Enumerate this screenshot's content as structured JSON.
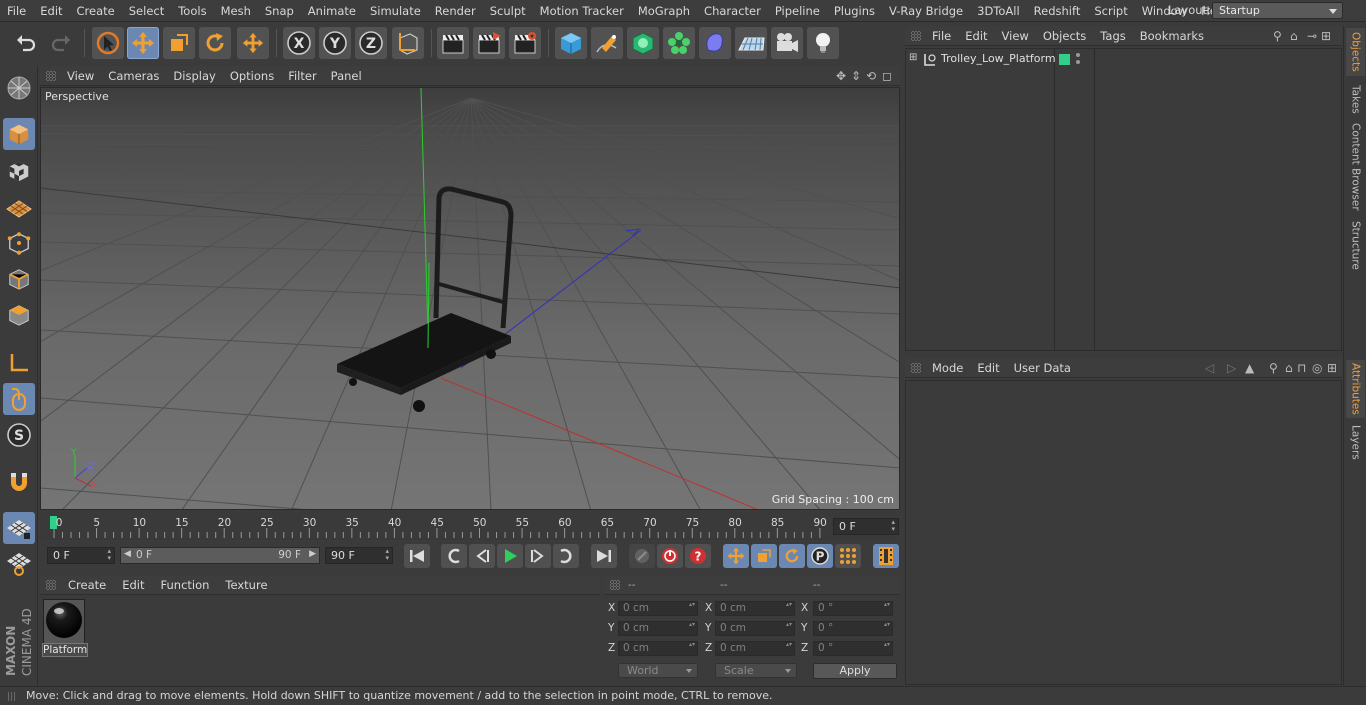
{
  "menubar": {
    "items": [
      "File",
      "Edit",
      "Create",
      "Select",
      "Tools",
      "Mesh",
      "Snap",
      "Animate",
      "Simulate",
      "Render",
      "Sculpt",
      "Motion Tracker",
      "MoGraph",
      "Character",
      "Pipeline",
      "Plugins",
      "V-Ray Bridge",
      "3DToAll",
      "Redshift",
      "Script",
      "Window",
      "Help"
    ],
    "layout_label": "Layout:",
    "layout_value": "Startup"
  },
  "toolbar": {
    "axis_x": "X",
    "axis_y": "Y",
    "axis_z": "Z"
  },
  "viewport": {
    "menu": [
      "View",
      "Cameras",
      "Display",
      "Options",
      "Filter",
      "Panel"
    ],
    "label": "Perspective",
    "grid_spacing": "Grid Spacing : 100 cm",
    "axis_x": "X",
    "axis_y": "Y",
    "axis_z": "Z"
  },
  "timeline": {
    "ticks": [
      "0",
      "5",
      "10",
      "15",
      "20",
      "25",
      "30",
      "35",
      "40",
      "45",
      "50",
      "55",
      "60",
      "65",
      "70",
      "75",
      "80",
      "85",
      "90"
    ],
    "current_frame": "0 F"
  },
  "transport": {
    "start_field": "0 F",
    "range_start": "0 F",
    "range_end": "90 F",
    "end_field": "90 F"
  },
  "material_manager": {
    "menu": [
      "Create",
      "Edit",
      "Function",
      "Texture"
    ],
    "materials": [
      {
        "name": "Platform"
      }
    ]
  },
  "coordinates": {
    "headers": [
      "--",
      "--",
      "--"
    ],
    "rows": [
      {
        "pos_label": "X",
        "pos": "0 cm",
        "size_label": "X",
        "size": "0 cm",
        "rot_label": "X",
        "rot": "0 °"
      },
      {
        "pos_label": "Y",
        "pos": "0 cm",
        "size_label": "Y",
        "size": "0 cm",
        "rot_label": "Y",
        "rot": "0 °"
      },
      {
        "pos_label": "Z",
        "pos": "0 cm",
        "size_label": "Z",
        "size": "0 cm",
        "rot_label": "Z",
        "rot": "0 °"
      }
    ],
    "mode_select": "World",
    "scale_select": "Scale",
    "apply_label": "Apply"
  },
  "object_manager": {
    "menu": [
      "File",
      "Edit",
      "View",
      "Objects",
      "Tags",
      "Bookmarks"
    ],
    "objects": [
      {
        "name": "Trolley_Low_Platform"
      }
    ]
  },
  "attribute_manager": {
    "menu": [
      "Mode",
      "Edit",
      "User Data"
    ]
  },
  "right_tabs": [
    "Objects",
    "Takes",
    "Content Browser",
    "Structure",
    "Attributes",
    "Layers"
  ],
  "brand": {
    "line1": "MAXON",
    "line2": "CINEMA 4D"
  },
  "status": "Move: Click and drag to move elements. Hold down SHIFT to quantize movement / add to the selection in point mode, CTRL to remove.",
  "colors": {
    "accent": "#6b88b3",
    "highlight": "#f0a040",
    "green_tag": "#2fd18a"
  }
}
